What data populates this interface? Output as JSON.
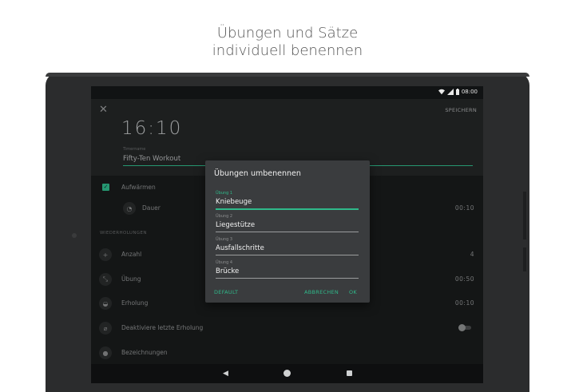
{
  "caption": {
    "line1": "Übungen und Sätze",
    "line2": "individuell benennen"
  },
  "status": {
    "time": "08:00"
  },
  "header": {
    "save_label": "SPEICHERN",
    "timer": "16:10",
    "name_label": "Timername",
    "name_value": "Fifty-Ten Workout"
  },
  "rows": {
    "warmup": "Aufwärmen",
    "duration": "Dauer",
    "duration_value": "00:10",
    "section": "WIEDERHOLUNGEN",
    "count": "Anzahl",
    "count_value": "4",
    "exercise": "Übung",
    "exercise_value": "00:50",
    "rest": "Erholung",
    "rest_value": "00:10",
    "disable_last_rest": "Deaktiviere letzte Erholung",
    "labels": "Bezeichnungen"
  },
  "dialog": {
    "title": "Übungen umbenennen",
    "fields": [
      {
        "label": "Übung 1",
        "value": "Kniebeuge"
      },
      {
        "label": "Übung 2",
        "value": "Liegestütze"
      },
      {
        "label": "Übung 3",
        "value": "Ausfallschritte"
      },
      {
        "label": "Übung 4",
        "value": "Brücke"
      }
    ],
    "default_label": "DEFAULT",
    "cancel_label": "ABBRECHEN",
    "ok_label": "OK"
  },
  "colors": {
    "accent": "#2fb98a",
    "background": "#191b1c",
    "dialog": "#3a3c3e"
  }
}
